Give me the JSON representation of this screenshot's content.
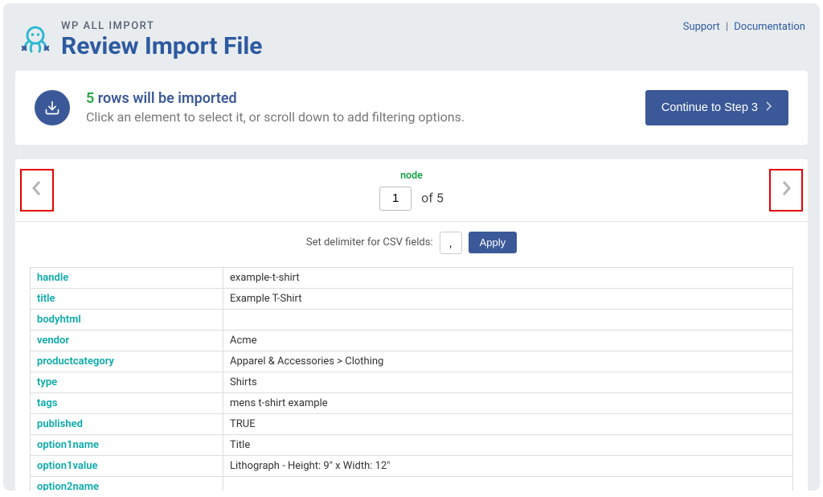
{
  "header": {
    "app_name": "WP ALL IMPORT",
    "page_title": "Review Import File",
    "links": {
      "support": "Support",
      "docs": "Documentation"
    }
  },
  "info": {
    "count": "5",
    "count_suffix": " rows will be imported",
    "subtext": "Click an element to select it, or scroll down to add filtering options.",
    "continue_label": "Continue to Step 3"
  },
  "pager": {
    "node_label": "node",
    "current": "1",
    "of_text": "of 5"
  },
  "delimiter": {
    "label": "Set delimiter for CSV fields:",
    "value": ",",
    "apply_label": "Apply"
  },
  "fields": [
    {
      "key": "handle",
      "value": "example-t-shirt"
    },
    {
      "key": "title",
      "value": "Example T-Shirt"
    },
    {
      "key": "bodyhtml",
      "value": ""
    },
    {
      "key": "vendor",
      "value": "Acme"
    },
    {
      "key": "productcategory",
      "value": "Apparel & Accessories > Clothing"
    },
    {
      "key": "type",
      "value": "Shirts"
    },
    {
      "key": "tags",
      "value": "mens t-shirt example"
    },
    {
      "key": "published",
      "value": "TRUE"
    },
    {
      "key": "option1name",
      "value": "Title"
    },
    {
      "key": "option1value",
      "value": "Lithograph - Height: 9\" x Width: 12\""
    },
    {
      "key": "option2name",
      "value": ""
    }
  ]
}
